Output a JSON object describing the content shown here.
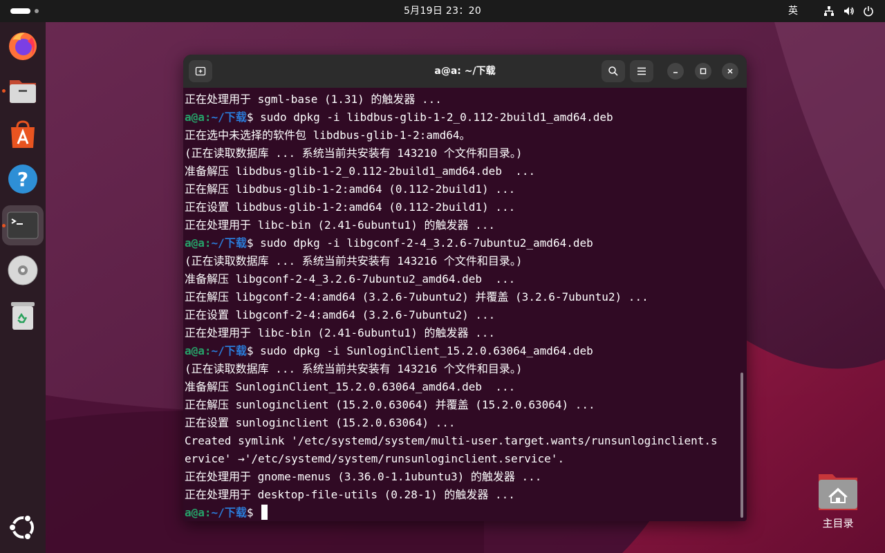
{
  "topbar": {
    "clock": "5月19日 23：20",
    "input_method": "英",
    "tray_icons": [
      "network-icon",
      "volume-icon",
      "power-icon"
    ]
  },
  "dock": {
    "items": [
      {
        "name": "firefox",
        "icon": "firefox-icon",
        "running": false
      },
      {
        "name": "files",
        "icon": "files-icon",
        "running": true
      },
      {
        "name": "app-center",
        "icon": "app-center-icon",
        "running": false
      },
      {
        "name": "help",
        "icon": "help-icon",
        "running": false
      },
      {
        "name": "terminal",
        "icon": "terminal-icon",
        "running": true,
        "active": true
      },
      {
        "name": "disc",
        "icon": "disc-icon",
        "running": false
      },
      {
        "name": "trash",
        "icon": "trash-icon",
        "running": false
      },
      {
        "name": "show-apps",
        "icon": "ubuntu-icon",
        "running": false
      }
    ]
  },
  "terminal": {
    "title": "a@a: ~/下载",
    "prompt_user": "a@a",
    "prompt_sep": ":",
    "prompt_path": "~/下载",
    "prompt_symbol": "$ ",
    "lines": [
      {
        "type": "out",
        "text": "正在处理用于 sgml-base (1.31) 的触发器 ..."
      },
      {
        "type": "cmd",
        "text": "sudo dpkg -i libdbus-glib-1-2_0.112-2build1_amd64.deb"
      },
      {
        "type": "out",
        "text": "正在选中未选择的软件包 libdbus-glib-1-2:amd64。"
      },
      {
        "type": "out",
        "text": "(正在读取数据库 ... 系统当前共安装有 143210 个文件和目录。)"
      },
      {
        "type": "out",
        "text": "准备解压 libdbus-glib-1-2_0.112-2build1_amd64.deb  ..."
      },
      {
        "type": "out",
        "text": "正在解压 libdbus-glib-1-2:amd64 (0.112-2build1) ..."
      },
      {
        "type": "out",
        "text": "正在设置 libdbus-glib-1-2:amd64 (0.112-2build1) ..."
      },
      {
        "type": "out",
        "text": "正在处理用于 libc-bin (2.41-6ubuntu1) 的触发器 ..."
      },
      {
        "type": "cmd",
        "text": "sudo dpkg -i libgconf-2-4_3.2.6-7ubuntu2_amd64.deb"
      },
      {
        "type": "out",
        "text": "(正在读取数据库 ... 系统当前共安装有 143216 个文件和目录。)"
      },
      {
        "type": "out",
        "text": "准备解压 libgconf-2-4_3.2.6-7ubuntu2_amd64.deb  ..."
      },
      {
        "type": "out",
        "text": "正在解压 libgconf-2-4:amd64 (3.2.6-7ubuntu2) 并覆盖 (3.2.6-7ubuntu2) ..."
      },
      {
        "type": "out",
        "text": "正在设置 libgconf-2-4:amd64 (3.2.6-7ubuntu2) ..."
      },
      {
        "type": "out",
        "text": "正在处理用于 libc-bin (2.41-6ubuntu1) 的触发器 ..."
      },
      {
        "type": "cmd",
        "text": "sudo dpkg -i SunloginClient_15.2.0.63064_amd64.deb"
      },
      {
        "type": "out",
        "text": "(正在读取数据库 ... 系统当前共安装有 143216 个文件和目录。)"
      },
      {
        "type": "out",
        "text": "准备解压 SunloginClient_15.2.0.63064_amd64.deb  ..."
      },
      {
        "type": "out",
        "text": "正在解压 sunloginclient (15.2.0.63064) 并覆盖 (15.2.0.63064) ..."
      },
      {
        "type": "out",
        "text": "正在设置 sunloginclient (15.2.0.63064) ..."
      },
      {
        "type": "out",
        "text": "Created symlink '/etc/systemd/system/multi-user.target.wants/runsunloginclient.s"
      },
      {
        "type": "out",
        "text": "ervice' →'/etc/systemd/system/runsunloginclient.service'."
      },
      {
        "type": "out",
        "text": "正在处理用于 gnome-menus (3.36.0-1.1ubuntu3) 的触发器 ..."
      },
      {
        "type": "out",
        "text": "正在处理用于 desktop-file-utils (0.28-1) 的触发器 ..."
      },
      {
        "type": "prompt",
        "text": ""
      }
    ]
  },
  "desktop": {
    "home_label": "主目录",
    "home_icon": "home-folder-icon"
  },
  "colors": {
    "terminal_bg": "#300a24",
    "prompt_user": "#26a269",
    "prompt_path": "#2a7bd8",
    "accent": "#e95420"
  }
}
